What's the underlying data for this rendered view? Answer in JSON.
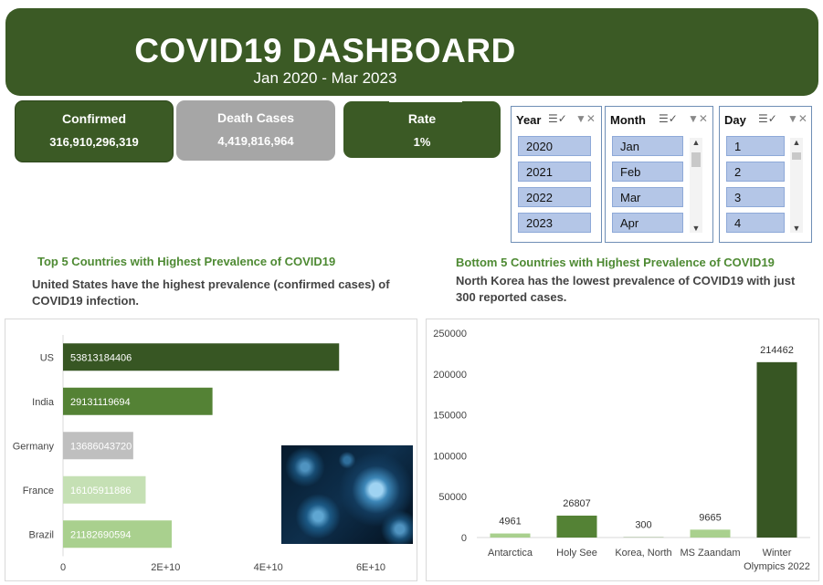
{
  "header": {
    "title": "COVID19 DASHBOARD",
    "subtitle": "Jan 2020 - Mar 2023"
  },
  "kpis": {
    "confirmed": {
      "label": "Confirmed",
      "value": "316,910,296,319"
    },
    "deaths": {
      "label": "Death Cases",
      "value": "4,419,816,964"
    },
    "rate": {
      "label": "Rate",
      "value": "1%"
    }
  },
  "slicers": {
    "year": {
      "label": "Year",
      "items": [
        "2020",
        "2021",
        "2022",
        "2023"
      ]
    },
    "month": {
      "label": "Month",
      "items": [
        "Jan",
        "Feb",
        "Mar",
        "Apr"
      ]
    },
    "day": {
      "label": "Day",
      "items": [
        "1",
        "2",
        "3",
        "4"
      ]
    }
  },
  "icons": {
    "multi_select": "multi-select-icon",
    "clear_filter": "clear-filter-icon",
    "virus_image": "coronavirus-image"
  },
  "colors": {
    "dark_green": "#3b5a25",
    "mid_green": "#548235",
    "light_green": "#a9d08e",
    "grey": "#bfbfbf",
    "slicer_item": "#b4c6e7"
  },
  "sections": {
    "top": {
      "title": "Top 5 Countries with Highest Prevalence of COVID19",
      "note": "United States have the highest prevalence (confirmed cases) of COVID19 infection."
    },
    "bottom": {
      "title": "Bottom 5 Countries with Highest Prevalence of COVID19",
      "note": "North Korea has the lowest prevalence of COVID19 with just 300 reported cases."
    }
  },
  "chart_data": [
    {
      "type": "bar",
      "orientation": "horizontal",
      "categories": [
        "US",
        "India",
        "Germany",
        "France",
        "Brazil"
      ],
      "values": [
        53813184406,
        29131119694,
        13686043720,
        16105911886,
        21182690594
      ],
      "value_labels": [
        "53813184406",
        "29131119694",
        "13686043720",
        "16105911886",
        "21182690594"
      ],
      "bar_colors": [
        "#375623",
        "#548235",
        "#bfbfbf",
        "#c5e0b4",
        "#a9d08e"
      ],
      "xlim": [
        0,
        60000000000
      ],
      "xticks": [
        0,
        20000000000,
        40000000000,
        60000000000
      ],
      "xtick_labels": [
        "0",
        "2E+10",
        "4E+10",
        "6E+10"
      ],
      "grid": false
    },
    {
      "type": "bar",
      "orientation": "vertical",
      "categories": [
        "Antarctica",
        "Holy See",
        "Korea, North",
        "MS Zaandam",
        "Winter Olympics 2022"
      ],
      "category_label_lines": [
        [
          "Antarctica"
        ],
        [
          "Holy See"
        ],
        [
          "Korea, North"
        ],
        [
          "MS Zaandam"
        ],
        [
          "Winter",
          "Olympics 2022"
        ]
      ],
      "values": [
        4961,
        26807,
        300,
        9665,
        214462
      ],
      "value_labels": [
        "4961",
        "26807",
        "300",
        "9665",
        "214462"
      ],
      "bar_colors": [
        "#a9d08e",
        "#548235",
        "#548235",
        "#a9d08e",
        "#375623"
      ],
      "ylim": [
        0,
        250000
      ],
      "yticks": [
        0,
        50000,
        100000,
        150000,
        200000,
        250000
      ],
      "ytick_labels": [
        "0",
        "50000",
        "100000",
        "150000",
        "200000",
        "250000"
      ],
      "grid": false
    }
  ]
}
